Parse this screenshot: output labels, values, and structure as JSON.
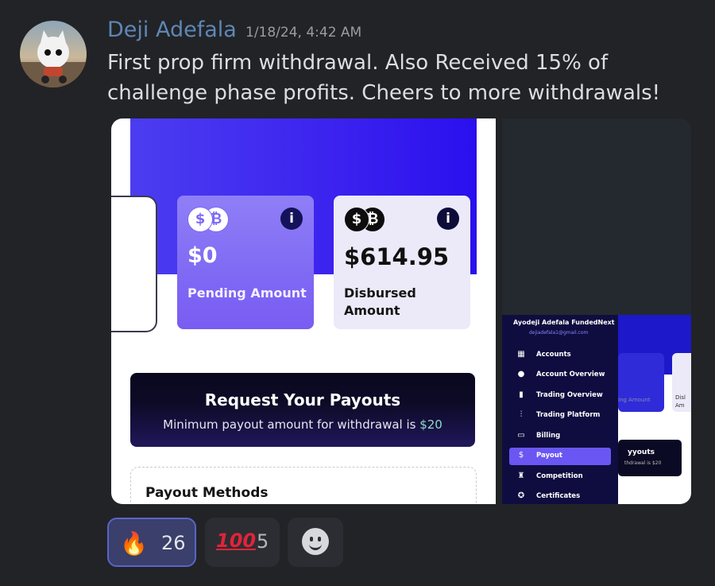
{
  "message": {
    "author": "Deji Adefala",
    "timestamp": "1/18/24, 4:42 AM",
    "text": "First prop firm withdrawal. Also Received 15% of challenge phase profits. Cheers to more withdrawals!"
  },
  "screenshot_left": {
    "cards": [
      {
        "amount": "$0",
        "label": "Pending Amount",
        "icon": "coins-icon"
      },
      {
        "amount": "$614.95",
        "label_line1": "Disbursed",
        "label_line2": "Amount",
        "icon": "coins-icon"
      }
    ],
    "info_glyph": "i",
    "coin_glyphs": [
      "$",
      "₿"
    ],
    "payout": {
      "title": "Request Your Payouts",
      "subtitle_prefix": "Minimum payout amount for withdrawal is ",
      "subtitle_amount": "$20"
    },
    "methods_title": "Payout Methods"
  },
  "screenshot_right": {
    "account_name": "Ayodeji Adefala FundedNext",
    "account_email": "dejiadefala1@gmail.com",
    "menu": [
      {
        "label": "Accounts",
        "icon": "grid-icon",
        "glyph": "▦",
        "active": false
      },
      {
        "label": "Account Overview",
        "icon": "user-icon",
        "glyph": "●",
        "active": false
      },
      {
        "label": "Trading Overview",
        "icon": "bar-chart-icon",
        "glyph": "▮",
        "active": false
      },
      {
        "label": "Trading Platform",
        "icon": "chart-icon",
        "glyph": "⫶",
        "active": false
      },
      {
        "label": "Billing",
        "icon": "card-icon",
        "glyph": "▭",
        "active": false
      },
      {
        "label": "Payout",
        "icon": "dollar-icon",
        "glyph": "$",
        "active": true
      },
      {
        "label": "Competition",
        "icon": "trophy-icon",
        "glyph": "♜",
        "active": false
      },
      {
        "label": "Certificates",
        "icon": "badge-icon",
        "glyph": "✪",
        "active": false
      }
    ],
    "peek_texts": {
      "amount": "ing Amount",
      "disb": "Disl",
      "am": "Am",
      "payouts": "yyouts",
      "withdraw": "thdrawal is $20",
      "dollar": "$",
      "s": "S("
    }
  },
  "reactions": [
    {
      "emoji": "🔥",
      "count": "26",
      "active": true
    },
    {
      "emoji": "💯",
      "text": "100",
      "count": "5",
      "active": false
    },
    {
      "icon": "add-reaction-icon"
    }
  ],
  "colors": {
    "author": "#5e87b6",
    "accent_purple": "#6a56f2",
    "background": "#222326"
  }
}
